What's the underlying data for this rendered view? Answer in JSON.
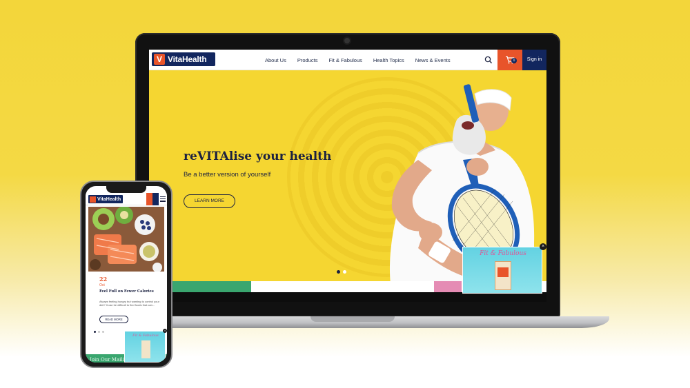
{
  "desktop": {
    "brand": "VitaHealth",
    "nav": {
      "items": [
        "About Us",
        "Products",
        "Fit & Fabulous",
        "Health Topics",
        "News & Events"
      ],
      "cart_count": "0",
      "signin_label": "Sign in"
    },
    "hero": {
      "title": "reVITAlise your health",
      "subtitle": "Be a better version of yourself",
      "cta_label": "LEARN MORE",
      "slide_count": 2,
      "active_slide": 1
    },
    "promo": {
      "title": "Fit & Fabulous",
      "close_symbol": "×"
    },
    "colors": {
      "accent_orange": "#e8542a",
      "brand_navy": "#12265e",
      "hero_yellow": "#f5d631",
      "bar_green": "#3aa66f",
      "bar_pink": "#e58cb4",
      "promo_cyan": "#63d2e2"
    }
  },
  "mobile": {
    "brand": "VitaHealth",
    "article": {
      "day": "22",
      "month": "Oct",
      "headline": "Feel Full on Fewer Calories",
      "excerpt": "Always feeling hungry but wanting to control your diet? It can be difficult to find foods that can...",
      "cta_label": "READ MORE"
    },
    "promo": {
      "title": "Fit & Fabulous",
      "close_symbol": "×"
    },
    "mailing_label": "Join Our Mailing List"
  }
}
